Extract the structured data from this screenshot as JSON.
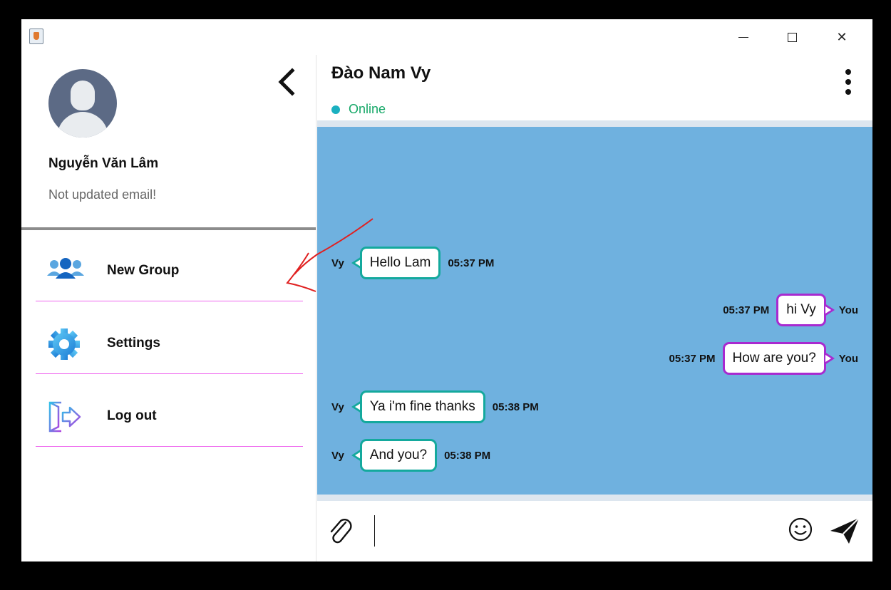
{
  "window": {
    "app_icon": "java-cup-icon",
    "controls": {
      "minimize": "minimize-icon",
      "maximize": "maximize-icon",
      "close": "close-icon",
      "close_glyph": "✕"
    }
  },
  "profile": {
    "name": "Nguyễn Văn Lâm",
    "email": "Not updated email!",
    "back_icon": "chevron-left-icon"
  },
  "menu": {
    "items": [
      {
        "label": "New Group",
        "icon": "group-icon"
      },
      {
        "label": "Settings",
        "icon": "gear-icon"
      },
      {
        "label": "Log out",
        "icon": "logout-icon"
      }
    ]
  },
  "chat": {
    "contact_name": "Đào Nam Vy",
    "status": "Online",
    "messages": [
      {
        "sender": "Vy",
        "text": "Hello Lam",
        "time": "05:37 PM",
        "direction": "in"
      },
      {
        "sender": "You",
        "text": "hi Vy",
        "time": "05:37 PM",
        "direction": "out"
      },
      {
        "sender": "You",
        "text": "How are you?",
        "time": "05:37 PM",
        "direction": "out"
      },
      {
        "sender": "Vy",
        "text": "Ya i'm fine thanks",
        "time": "05:38 PM",
        "direction": "in"
      },
      {
        "sender": "Vy",
        "text": "And you?",
        "time": "05:38 PM",
        "direction": "in"
      }
    ]
  },
  "composer": {
    "value": "",
    "attach_icon": "paperclip-icon",
    "emoji_icon": "smiley-icon",
    "send_icon": "paper-plane-icon"
  },
  "colors": {
    "chat_background": "#6fb1df",
    "incoming_border": "#14a99d",
    "outgoing_border": "#a82ad0",
    "online": "#16a868",
    "menu_divider": "#ee66ee"
  }
}
